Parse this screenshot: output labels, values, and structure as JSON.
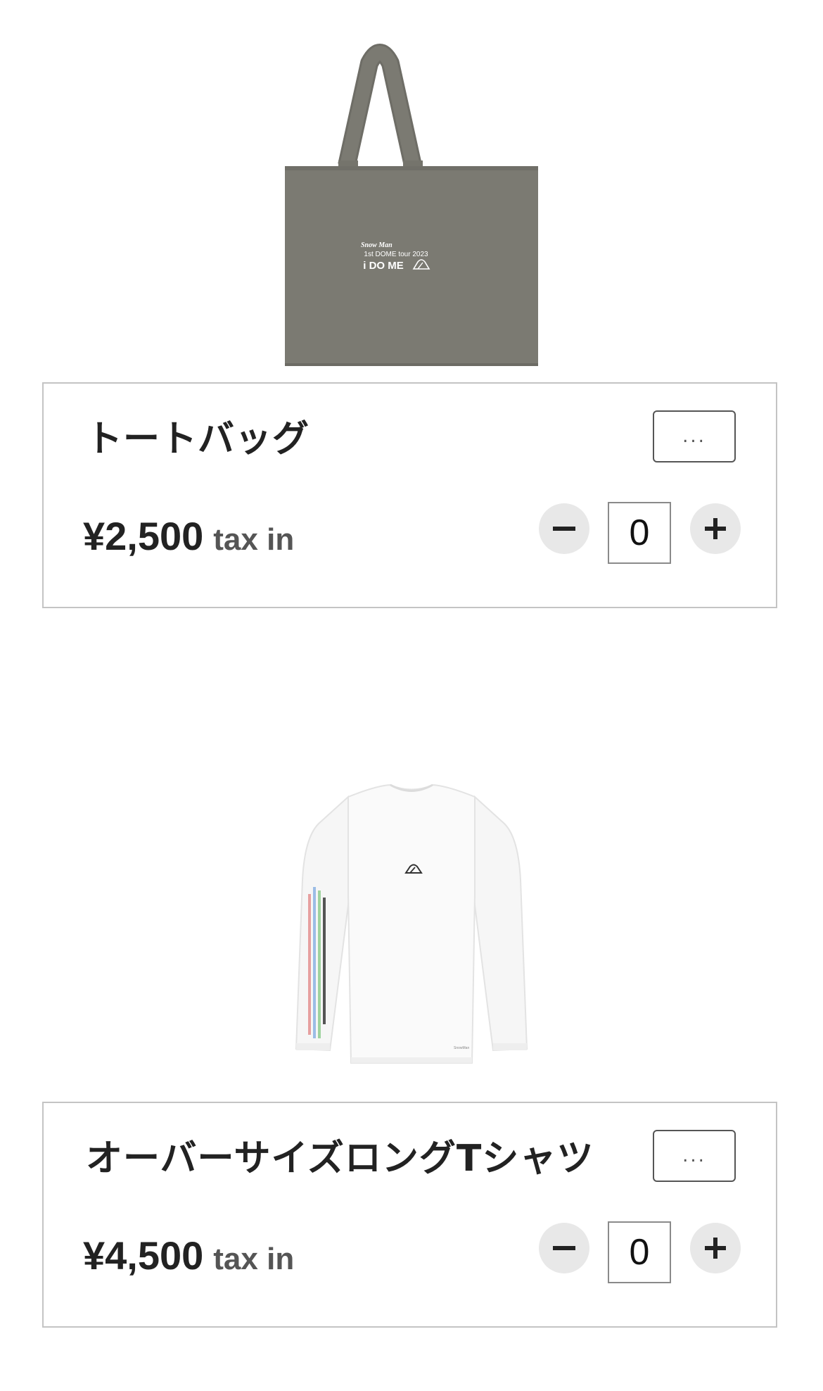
{
  "products": [
    {
      "name": "トートバッグ",
      "price": "¥2,500",
      "tax_label": "tax in",
      "more_label": "...",
      "quantity": "0",
      "image": {
        "type": "tote-bag",
        "color": "#7b7a72",
        "print_brand": "Snow Man",
        "print_line1": "1st DOME tour 2023",
        "print_line2": "i DO ME"
      }
    },
    {
      "name": "オーバーサイズロングTシャツ",
      "price": "¥4,500",
      "tax_label": "tax in",
      "more_label": "...",
      "quantity": "0",
      "image": {
        "type": "long-sleeve-tshirt",
        "color": "#f7f7f7"
      }
    }
  ],
  "icons": {
    "minus": "minus-icon",
    "plus": "plus-icon"
  }
}
